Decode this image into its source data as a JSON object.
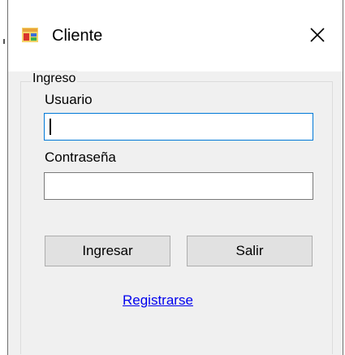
{
  "window": {
    "title": "Cliente",
    "app_icon": "windows-form-icon",
    "close_icon": "close-icon"
  },
  "form": {
    "group_label": "Ingreso",
    "usuario_label": "Usuario",
    "usuario_value": "",
    "contrasena_label": "Contraseña",
    "contrasena_value": "",
    "ingresar_label": "Ingresar",
    "salir_label": "Salir",
    "registrarse_label": "Registrarse"
  },
  "colors": {
    "focus_border": "#0078d7",
    "link": "#0000ee",
    "button_face": "#e1e1e1",
    "window_bg": "#f0f0f0"
  }
}
